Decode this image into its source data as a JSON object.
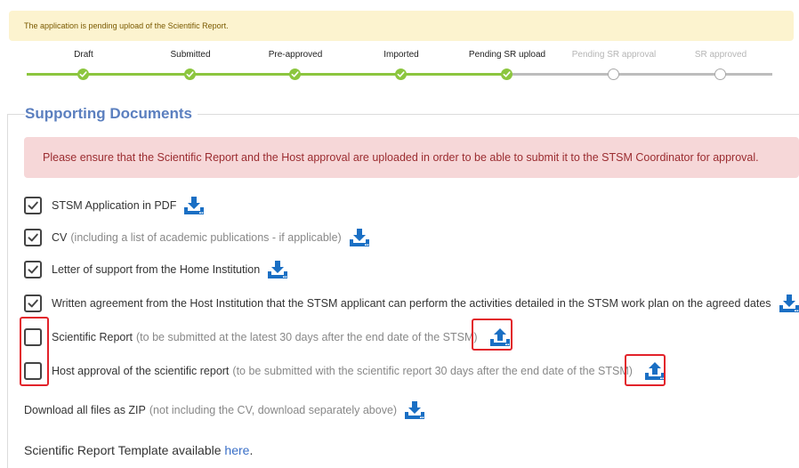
{
  "banner": {
    "text": "The application is pending upload of the Scientific Report."
  },
  "stepper": {
    "steps": [
      {
        "label": "Draft",
        "state": "done"
      },
      {
        "label": "Submitted",
        "state": "done"
      },
      {
        "label": "Pre-approved",
        "state": "done"
      },
      {
        "label": "Imported",
        "state": "done"
      },
      {
        "label": "Pending SR upload",
        "state": "done"
      },
      {
        "label": "Pending SR approval",
        "state": "todo"
      },
      {
        "label": "SR approved",
        "state": "todo"
      }
    ],
    "done_color": "#8cc63f",
    "todo_color": "#bdbdbd"
  },
  "section": {
    "title": "Supporting Documents"
  },
  "alert": {
    "text": "Please ensure that the Scientific Report and the Host approval are uploaded in order to be able to submit it to the STSM Coordinator for approval."
  },
  "documents": [
    {
      "label": "STSM Application in PDF",
      "note": "",
      "checked": true,
      "icon": "download-icon"
    },
    {
      "label": "CV",
      "note": "(including a list of academic publications - if applicable)",
      "checked": true,
      "icon": "download-icon"
    },
    {
      "label": "Letter of support from the Home Institution",
      "note": "",
      "checked": true,
      "icon": "download-icon"
    },
    {
      "label": "Written agreement from the Host Institution that the STSM applicant can perform the activities detailed in the STSM work plan on the agreed dates",
      "note": "",
      "checked": true,
      "icon": "download-icon"
    },
    {
      "label": "Scientific Report",
      "note": "(to be submitted at the latest 30 days after the end date of the STSM)",
      "checked": false,
      "icon": "upload-icon"
    },
    {
      "label": "Host approval of the scientific report",
      "note": "(to be submitted with the scientific report 30 days after the end date of the STSM)",
      "checked": false,
      "icon": "upload-icon"
    }
  ],
  "zip": {
    "label": "Download all files as ZIP",
    "note": "(not including the CV, download separately above)",
    "icon": "download-icon"
  },
  "template": {
    "text": "Scientific Report Template available ",
    "link": "here",
    "suffix": "."
  },
  "colors": {
    "icon_blue": "#1a6fc4",
    "highlight_red": "#e2222a",
    "legend_blue": "#5b7fbf"
  }
}
